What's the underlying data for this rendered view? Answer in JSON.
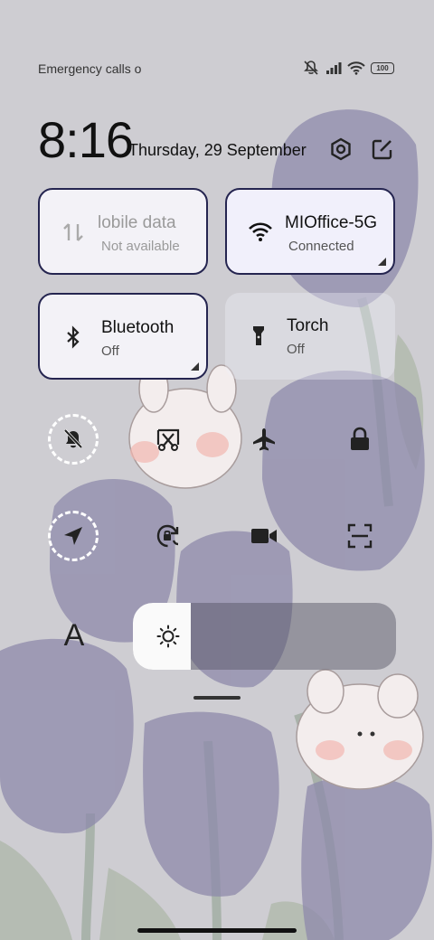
{
  "status_bar": {
    "carrier": "Emergency calls o",
    "battery": "100",
    "icons": [
      "mute-icon",
      "signal-icon",
      "wifi-icon",
      "battery-icon"
    ]
  },
  "header": {
    "time": "8:16",
    "date": "Thursday, 29 September",
    "icons": [
      "settings-icon",
      "edit-icon"
    ]
  },
  "tiles": [
    {
      "name": "Mobile data",
      "display": "lobile data",
      "status": "Not available",
      "state": "unavailable",
      "icon": "mobile-data-icon"
    },
    {
      "name": "Wi-Fi",
      "display": "MIOffice-5G",
      "status": "Connected",
      "state": "on",
      "icon": "wifi-icon"
    },
    {
      "name": "Bluetooth",
      "display": "Bluetooth",
      "status": "Off",
      "state": "on",
      "icon": "bluetooth-icon"
    },
    {
      "name": "Torch",
      "display": "Torch",
      "status": "Off",
      "state": "off",
      "icon": "torch-icon"
    }
  ],
  "toggles": [
    {
      "name": "silent",
      "icon": "bell-off-icon",
      "active": true
    },
    {
      "name": "screenshot",
      "icon": "screenshot-icon",
      "active": false
    },
    {
      "name": "airplane-mode",
      "icon": "airplane-icon",
      "active": false
    },
    {
      "name": "lock-screen",
      "icon": "lock-icon",
      "active": false
    },
    {
      "name": "location",
      "icon": "location-arrow-icon",
      "active": true
    },
    {
      "name": "auto-rotate",
      "icon": "rotate-lock-icon",
      "active": false
    },
    {
      "name": "screen-recorder",
      "icon": "video-camera-icon",
      "active": false
    },
    {
      "name": "scanner",
      "icon": "scan-icon",
      "active": false
    }
  ],
  "font_button": "A",
  "brightness": {
    "level": 0.22
  },
  "colors": {
    "accent_border": "#252550",
    "icon_dark": "#222222"
  }
}
